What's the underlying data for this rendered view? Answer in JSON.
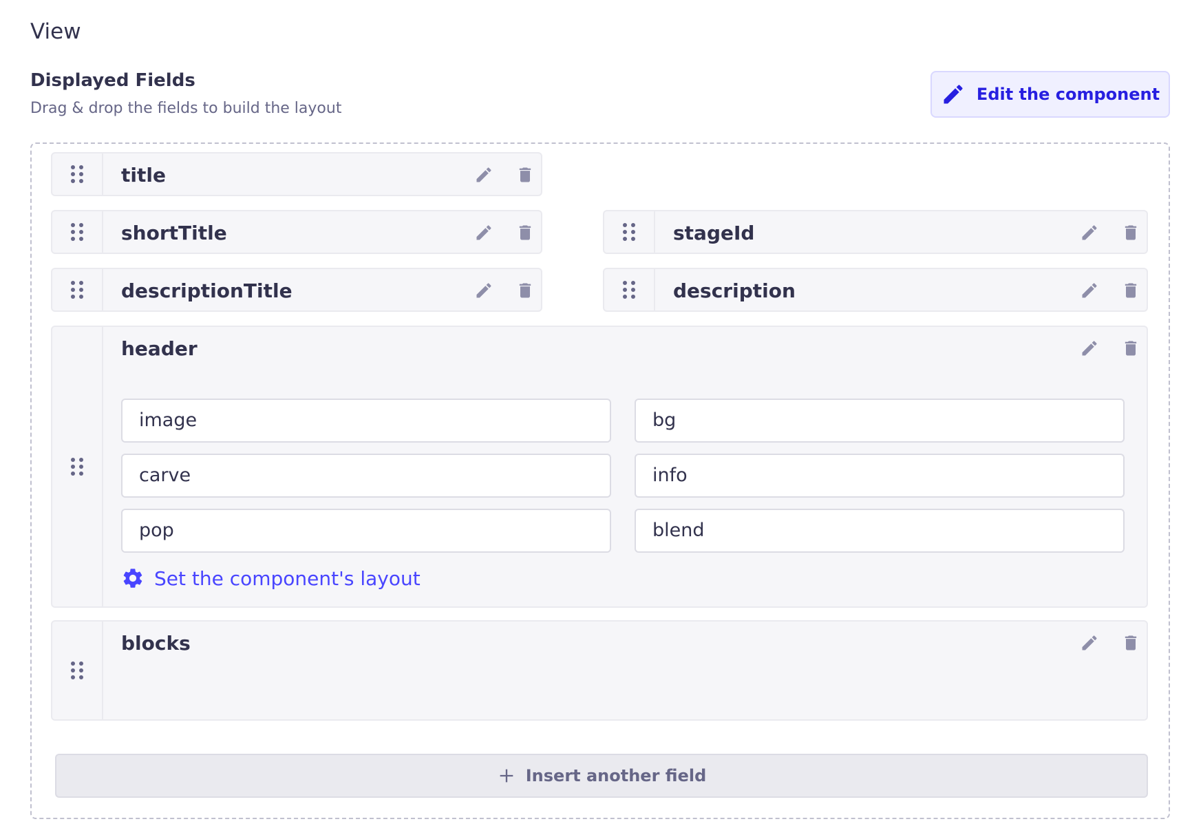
{
  "view": {
    "title": "View"
  },
  "section": {
    "title": "Displayed Fields",
    "subtitle": "Drag & drop the fields to build the layout",
    "edit_component_label": "Edit the component"
  },
  "fields": {
    "title": "title",
    "shortTitle": "shortTitle",
    "stageId": "stageId",
    "descriptionTitle": "descriptionTitle",
    "description": "description",
    "header": "header",
    "blocks": "blocks"
  },
  "header_component": {
    "sub_fields": [
      "image",
      "bg",
      "carve",
      "info",
      "pop",
      "blend"
    ],
    "set_layout_label": "Set the component's layout"
  },
  "insert_label": "Insert another field",
  "colors": {
    "primary": "#4945ff",
    "primary_dark": "#271fe0",
    "icon_gray": "#8e8ea9",
    "text": "#32324d",
    "subtext": "#666687"
  }
}
